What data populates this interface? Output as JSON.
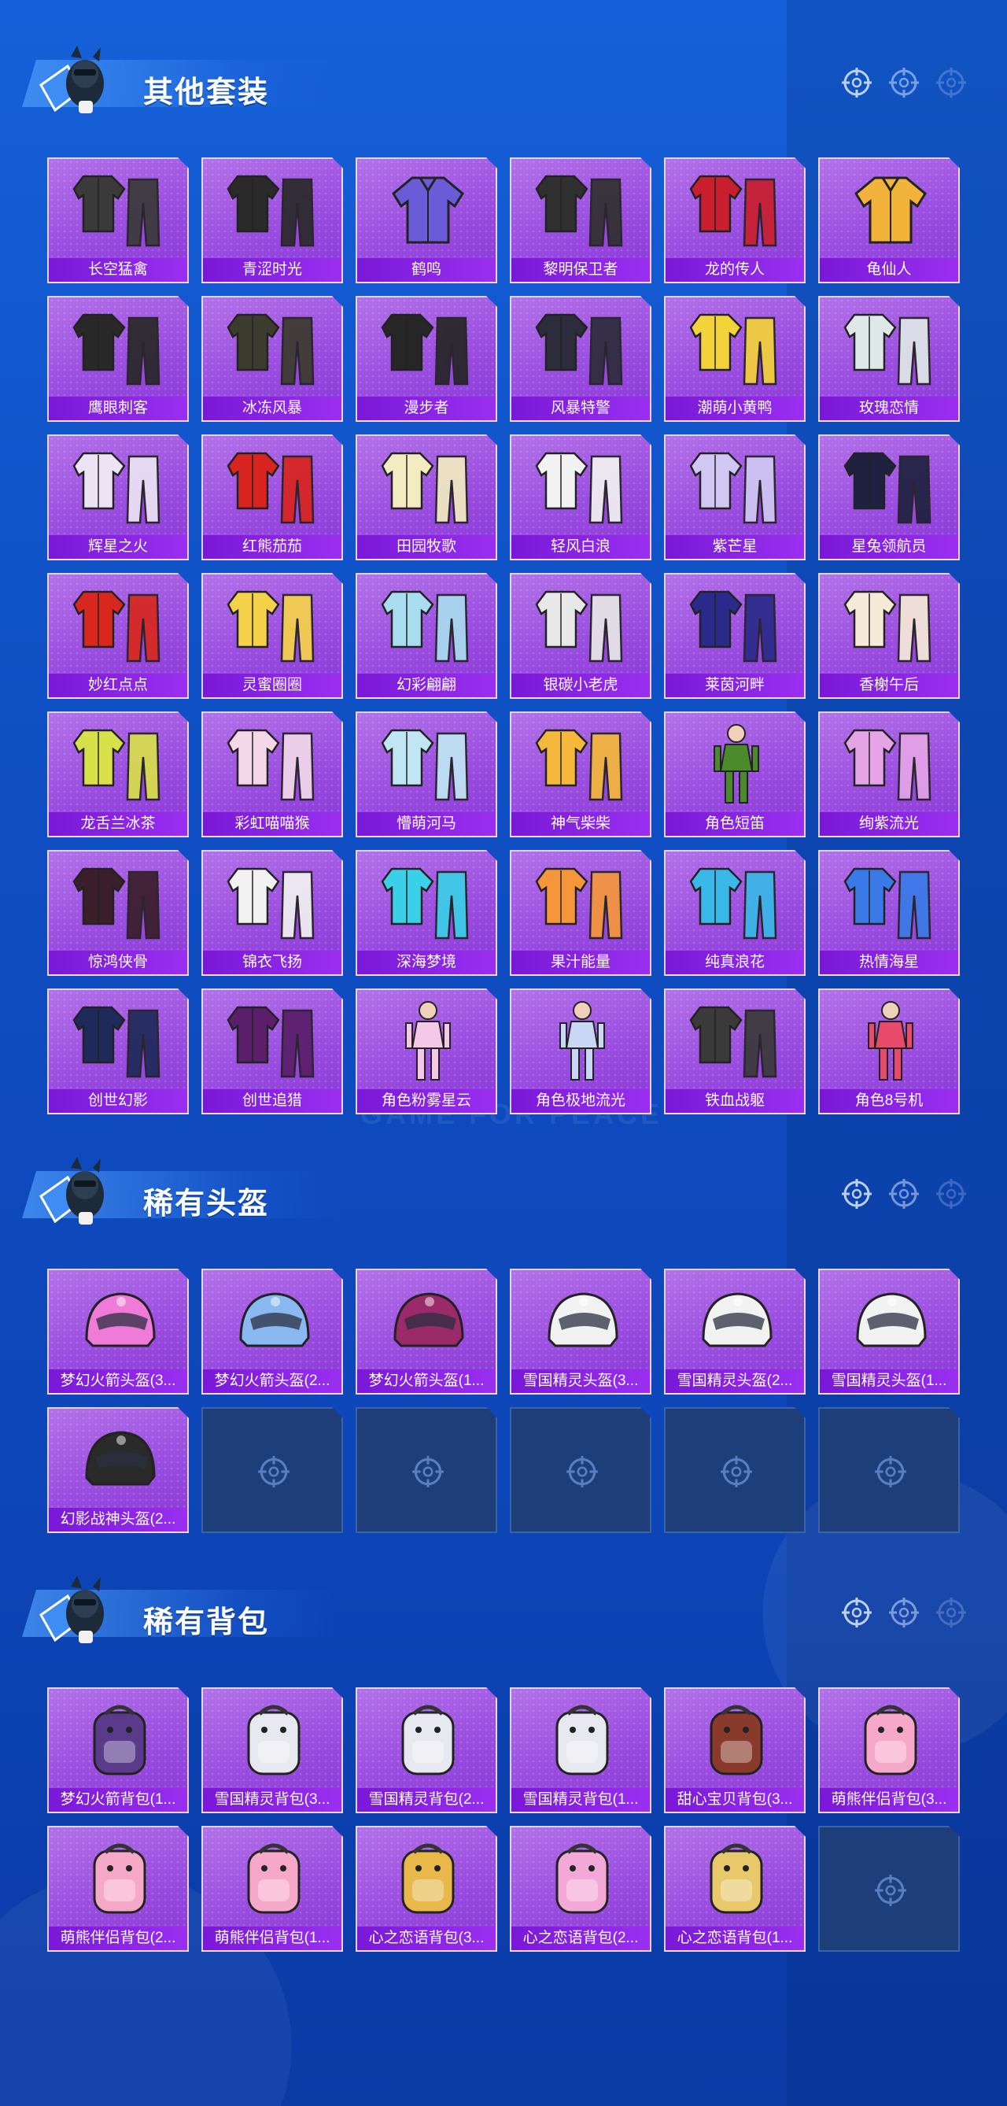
{
  "watermark": "GAME FOR PEACE",
  "sections": [
    {
      "title": "其他套装",
      "items": [
        {
          "label": "长空猛禽",
          "icon": "outfit-icon",
          "color": "#3a3a3a"
        },
        {
          "label": "青涩时光",
          "icon": "outfit-icon",
          "color": "#2a2a2a"
        },
        {
          "label": "鹤鸣",
          "icon": "jacket-icon",
          "color": "#6a5cd8"
        },
        {
          "label": "黎明保卫者",
          "icon": "outfit-icon",
          "color": "#303030"
        },
        {
          "label": "龙的传人",
          "icon": "outfit-icon",
          "color": "#c81e2e"
        },
        {
          "label": "龟仙人",
          "icon": "shirt-icon",
          "color": "#f2b33a"
        },
        {
          "label": "鹰眼刺客",
          "icon": "outfit-icon",
          "color": "#282828"
        },
        {
          "label": "冰冻风暴",
          "icon": "outfit-icon",
          "color": "#3b3b2e"
        },
        {
          "label": "漫步者",
          "icon": "outfit-icon",
          "color": "#262626"
        },
        {
          "label": "风暴特警",
          "icon": "outfit-icon",
          "color": "#2c2c3a"
        },
        {
          "label": "潮萌小黄鸭",
          "icon": "outfit-icon",
          "color": "#f4d23a"
        },
        {
          "label": "玫瑰恋情",
          "icon": "outfit-icon",
          "color": "#dfe8e8"
        },
        {
          "label": "辉星之火",
          "icon": "outfit-icon",
          "color": "#ece4f4"
        },
        {
          "label": "红熊茄茄",
          "icon": "outfit-icon",
          "color": "#d8241e"
        },
        {
          "label": "田园牧歌",
          "icon": "outfit-icon",
          "color": "#f2ecc0"
        },
        {
          "label": "轻风白浪",
          "icon": "outfit-icon",
          "color": "#f2f2f2"
        },
        {
          "label": "紫芒星",
          "icon": "outfit-icon",
          "color": "#d0c8f2"
        },
        {
          "label": "星兔领航员",
          "icon": "outfit-icon",
          "color": "#1e2240"
        },
        {
          "label": "妙红点点",
          "icon": "outfit-icon",
          "color": "#d8281e"
        },
        {
          "label": "灵蜜圈圈",
          "icon": "outfit-icon",
          "color": "#f6d24a"
        },
        {
          "label": "幻彩翩翩",
          "icon": "outfit-icon",
          "color": "#a8dcef"
        },
        {
          "label": "银碳小老虎",
          "icon": "outfit-icon",
          "color": "#e8e8e8"
        },
        {
          "label": "莱茵河畔",
          "icon": "outfit-icon",
          "color": "#2a2a8a"
        },
        {
          "label": "香榭午后",
          "icon": "outfit-icon",
          "color": "#f6ead8"
        },
        {
          "label": "龙舌兰冰茶",
          "icon": "outfit-icon",
          "color": "#d8e04a"
        },
        {
          "label": "彩虹喵喵猴",
          "icon": "outfit-icon",
          "color": "#f4d8ea"
        },
        {
          "label": "懵萌河马",
          "icon": "outfit-icon",
          "color": "#bfe6f2"
        },
        {
          "label": "神气柴柴",
          "icon": "outfit-icon",
          "color": "#f6b83a"
        },
        {
          "label": "角色短笛",
          "icon": "figure-icon",
          "color": "#4a8a2a"
        },
        {
          "label": "绚紫流光",
          "icon": "outfit-icon",
          "color": "#e4a4e6"
        },
        {
          "label": "惊鸿侠骨",
          "icon": "outfit-icon",
          "color": "#3a1e2a"
        },
        {
          "label": "锦衣飞扬",
          "icon": "outfit-icon",
          "color": "#f2f2f2"
        },
        {
          "label": "深海梦境",
          "icon": "outfit-icon",
          "color": "#3ad0e8"
        },
        {
          "label": "果汁能量",
          "icon": "outfit-icon",
          "color": "#f6963a"
        },
        {
          "label": "纯真浪花",
          "icon": "outfit-icon",
          "color": "#3ab8e8"
        },
        {
          "label": "热情海星",
          "icon": "outfit-icon",
          "color": "#3a7ae8"
        },
        {
          "label": "创世幻影",
          "icon": "outfit-icon",
          "color": "#1e2a5a"
        },
        {
          "label": "创世追猎",
          "icon": "outfit-icon",
          "color": "#5a1e6a"
        },
        {
          "label": "角色粉雾星云",
          "icon": "figure-icon",
          "color": "#f4c8e6"
        },
        {
          "label": "角色极地流光",
          "icon": "figure-icon",
          "color": "#c8d8f4"
        },
        {
          "label": "铁血战躯",
          "icon": "outfit-icon",
          "color": "#3a3a3a"
        },
        {
          "label": "角色8号机",
          "icon": "figure-icon",
          "color": "#e84a6a"
        }
      ],
      "empty_count": 0
    },
    {
      "title": "稀有头盔",
      "items": [
        {
          "label": "梦幻火箭头盔(3...",
          "icon": "helmet-icon",
          "color": "#f07ad8"
        },
        {
          "label": "梦幻火箭头盔(2...",
          "icon": "helmet-icon",
          "color": "#8ab8f0"
        },
        {
          "label": "梦幻火箭头盔(1...",
          "icon": "helmet-icon",
          "color": "#9a2a6a"
        },
        {
          "label": "雪国精灵头盔(3...",
          "icon": "helmet-icon",
          "color": "#f2f2f2"
        },
        {
          "label": "雪国精灵头盔(2...",
          "icon": "helmet-icon",
          "color": "#f2f2f2"
        },
        {
          "label": "雪国精灵头盔(1...",
          "icon": "helmet-icon",
          "color": "#f2f2f2"
        },
        {
          "label": "幻影战神头盔(2...",
          "icon": "helmet-icon",
          "color": "#2a2a2a"
        }
      ],
      "empty_count": 5
    },
    {
      "title": "稀有背包",
      "items": [
        {
          "label": "梦幻火箭背包(1...",
          "icon": "backpack-icon",
          "color": "#5a3a8a"
        },
        {
          "label": "雪国精灵背包(3...",
          "icon": "backpack-icon",
          "color": "#e8e8f0"
        },
        {
          "label": "雪国精灵背包(2...",
          "icon": "backpack-icon",
          "color": "#e8e8f0"
        },
        {
          "label": "雪国精灵背包(1...",
          "icon": "backpack-icon",
          "color": "#e8e8f0"
        },
        {
          "label": "甜心宝贝背包(3...",
          "icon": "backpack-icon",
          "color": "#8a3a2a"
        },
        {
          "label": "萌熊伴侣背包(3...",
          "icon": "backpack-icon",
          "color": "#f6a8c8"
        },
        {
          "label": "萌熊伴侣背包(2...",
          "icon": "backpack-icon",
          "color": "#f6a8c8"
        },
        {
          "label": "萌熊伴侣背包(1...",
          "icon": "backpack-icon",
          "color": "#f6a8c8"
        },
        {
          "label": "心之恋语背包(3...",
          "icon": "backpack-icon",
          "color": "#e8b84a"
        },
        {
          "label": "心之恋语背包(2...",
          "icon": "backpack-icon",
          "color": "#f4a8d8"
        },
        {
          "label": "心之恋语背包(1...",
          "icon": "backpack-icon",
          "color": "#e8c86a"
        }
      ],
      "empty_count": 1
    }
  ]
}
